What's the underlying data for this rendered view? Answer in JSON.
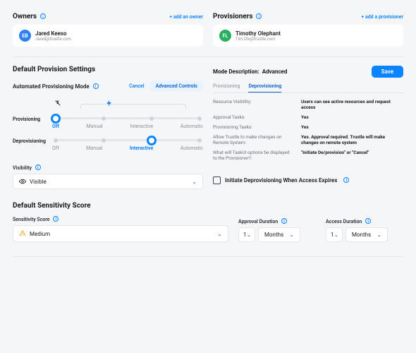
{
  "owners": {
    "title": "Owners",
    "add_link": "+  add an owner",
    "person": {
      "initials": "EB",
      "name": "Jared Keeso",
      "email": "Jared@trustle.com"
    }
  },
  "provisioners": {
    "title": "Provisioners",
    "add_link": "+ add a provisioner",
    "person": {
      "initials": "FL",
      "name": "Timothy Olephant",
      "email": "Tim.Ole@trustle.com"
    }
  },
  "settings": {
    "title": "Default Provision Settings",
    "mode_label": "Automated Provisioning Mode",
    "cancel": "Cancel",
    "advanced": "Advanced Controls",
    "rows": {
      "provisioning": {
        "label": "Provisioning",
        "options": [
          "Off",
          "Manual",
          "Interactive",
          "Automatic"
        ],
        "active": "Off",
        "thumb_pct": "0"
      },
      "deprovisioning": {
        "label": "Deprovisioning",
        "options": [
          "Off",
          "Manual",
          "Interactive",
          "Automatic"
        ],
        "active": "Interactive",
        "thumb_pct": "66.66"
      }
    },
    "visibility": {
      "label": "Visibility",
      "value": "Visible"
    }
  },
  "desc": {
    "save": "Save",
    "title_prefix": "Mode Description:",
    "title_value": "Advanced",
    "tabs": {
      "prov": "Provisioning",
      "deprov": "Deprovisioning"
    },
    "items": [
      {
        "k": "Resource Visibility:",
        "v": "Users can see active resources and request access"
      },
      {
        "k": "Approval Tasks:",
        "v": "Yes"
      },
      {
        "k": "Provisioning Tasks:",
        "v": "Yes"
      },
      {
        "k": "Allow Trustle to make changes on Remote System:",
        "v": "Yes. Approval required. Trustle will make changes on remote system"
      },
      {
        "k": "What will TaskUI options be displayed to the Provisioner?:",
        "v": "\"Initiate De/provision\" or \"Cancel\""
      }
    ],
    "checkbox_label": "Initiate Deprovisioning When Access Expires"
  },
  "sensitivity": {
    "title": "Default Sensitivity Score",
    "score_label": "Sensitivity Score",
    "score_value": "Medium",
    "approval": {
      "label": "Approval Duration",
      "num": "1",
      "unit": "Months"
    },
    "access": {
      "label": "Access Duration",
      "num": "1",
      "unit": "Months"
    }
  }
}
